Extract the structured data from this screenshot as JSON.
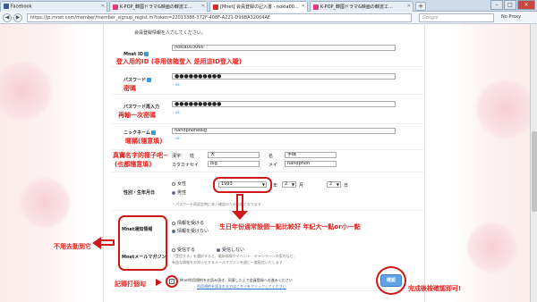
{
  "browser": {
    "tabs": [
      {
        "label": "Facebook",
        "icon_color": "#3b5998"
      },
      {
        "label": "K-POP_韓國ドラマ&映画の韓流エ...",
        "icon_color": "#e83c7a"
      },
      {
        "label": "[Mnet] 会員登録の記入書 - nokia00...",
        "icon_color": "#d42b2b"
      },
      {
        "label": "K-POP_韓國ドラマ&映画の韓流エ...",
        "icon_color": "#e83c7a"
      }
    ],
    "new_tab": "+",
    "url": "https://jp.mnet.com/member/member_signup_regist.m?token=22013386-372F-408F-A221-D99BA32064AE",
    "search_placeholder": "Google",
    "proxy": "No Proxy",
    "win_min": "–",
    "win_max": "□",
    "win_close": "✕"
  },
  "form": {
    "instruction": "会員登録情報を入力してください。",
    "mnet_id": {
      "label": "Mnet ID",
      "value": "nokia003066",
      "annotation": "登入用的ID (非用信箱登入 是用這ID登入喔)"
    },
    "password": {
      "label": "パスワード",
      "value": "●●●●●●●●●●",
      "ok": "・ok",
      "annotation": "密碼"
    },
    "password_confirm": {
      "label": "パスワード再入力",
      "value": "●●●●●●●●●●",
      "ok": "・ok",
      "annotation": "再輸一次密碼"
    },
    "nickname": {
      "label": "ニックネーム",
      "value": "handphonebig",
      "ok": "・ok",
      "annotation": "暱稱(隨意填)"
    },
    "name": {
      "annotation_1": "真實名字的樣子吧~",
      "annotation_2": "(也都隨意填)",
      "kanji_label": "漢字",
      "sei_label": "姓",
      "mei_label": "名",
      "kana_label": "カタカナ",
      "sei_kana_label": "セイ",
      "mei_kana_label": "メイ",
      "sei_value": "大",
      "mei_value": "手機",
      "sei_kana_value": "big",
      "mei_kana_value": "handphon"
    },
    "birth": {
      "label": "性別・生年月日",
      "gender_female": "女性",
      "gender_male": "男性",
      "year": "1993",
      "year_unit": "年",
      "month": "2",
      "month_unit": "月",
      "day": "2",
      "day_unit": "日",
      "hint": "・パスワード再設定時に本人確認のため必要となります",
      "annotation": "生日年份通常設個一點比較好 年紀大一點or小一點"
    },
    "mail": {
      "label": "Mnet通知情報",
      "opt_receive": "情報を受ける",
      "opt_no": "情報を受けない"
    },
    "magazine": {
      "label": "Mnetメールマガジン",
      "opt_receive": "受信する",
      "opt_no": "受信しない",
      "desc_1": "「受信する」を選択すると、最新情報やイベント・キャンペーンの案内など、",
      "desc_2": "有益な情報をお知らせするメールマガジンを週に一度配信いたします"
    },
    "side_annotation": "不用去動到它",
    "terms": {
      "text": "Mnet利用規約をお読み頂き、同意した上で会員登録へお進みください",
      "link": "利用規約",
      "sub": "利用規約を読まれる方はこちらをクリックしてください",
      "annotation": "記得打個勾"
    },
    "confirm_button": "確認",
    "confirm_annotation": "完成後按確認即可!"
  }
}
